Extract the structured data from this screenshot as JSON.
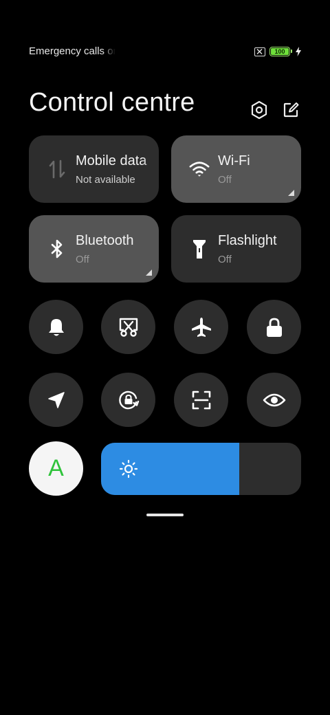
{
  "status_bar": {
    "carrier_text": "Emergency calls only",
    "battery_level": "100",
    "battery_percent": 100,
    "icons": [
      "no-sim-icon",
      "battery-icon",
      "charging-bolt-icon"
    ]
  },
  "header": {
    "title": "Control centre",
    "settings_icon": "settings-hexagon-icon",
    "edit_icon": "edit-icon"
  },
  "tiles": [
    {
      "label": "Mobile data",
      "sub": "Not available",
      "icon": "mobile-data-icon",
      "active": false
    },
    {
      "label": "Wi-Fi",
      "sub": "Off",
      "icon": "wifi-icon",
      "active": true
    },
    {
      "label": "Bluetooth",
      "sub": "Off",
      "icon": "bluetooth-icon",
      "active": true
    },
    {
      "label": "Flashlight",
      "sub": "Off",
      "icon": "flashlight-icon",
      "active": false
    }
  ],
  "toggles_row1": [
    "bell-icon",
    "screenshot-icon",
    "airplane-icon",
    "lock-icon"
  ],
  "toggles_row2": [
    "location-icon",
    "rotation-lock-icon",
    "scan-icon",
    "eye-icon"
  ],
  "brightness": {
    "auto_label": "A",
    "level_percent": 69,
    "icon": "sun-icon"
  },
  "colors": {
    "accent_blue": "#2d8ce3",
    "auto_green": "#2ec33a",
    "battery_green": "#6fe03b",
    "tile_bg": "#2d2d2d",
    "tile_active_bg": "#555555"
  }
}
